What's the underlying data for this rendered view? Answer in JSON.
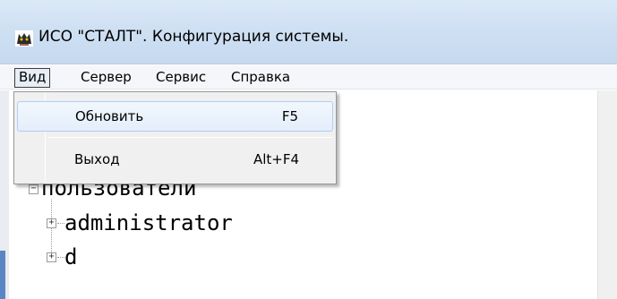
{
  "window": {
    "title": "ИСО \"СТАЛТ\". Конфигурация системы.",
    "icon": "app-cat-icon"
  },
  "menubar": {
    "items": [
      {
        "label": "Вид"
      },
      {
        "label": "Сервер"
      },
      {
        "label": "Сервис"
      },
      {
        "label": "Справка"
      }
    ]
  },
  "dropdown": {
    "items": [
      {
        "label": "Обновить",
        "shortcut": "F5"
      },
      {
        "label": "Выход",
        "shortcut": "Alt+F4"
      }
    ]
  },
  "tree": {
    "root_label": "пользователи",
    "children": [
      {
        "label": "administrator"
      },
      {
        "label": "d"
      }
    ]
  },
  "colors": {
    "titlebar": "#cfe0f3",
    "menu_hover": "#e3eefb",
    "accent_blue": "#5a86c4"
  }
}
